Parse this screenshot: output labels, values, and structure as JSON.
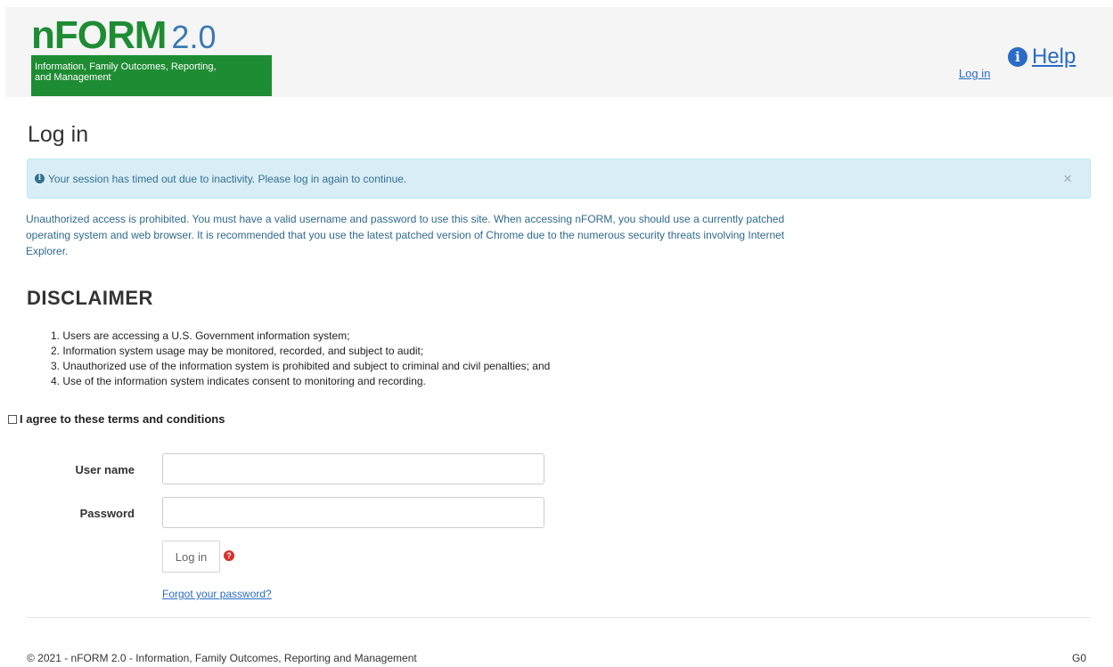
{
  "header": {
    "logo": {
      "n": "n",
      "form": "FORM",
      "version": "2.0",
      "line1": "Information, Family Outcomes, Reporting,",
      "line2": "and Management"
    },
    "login_link": "Log in",
    "help_link": "Help",
    "help_icon": "info-circle-icon"
  },
  "page_title": "Log in",
  "alert": {
    "icon": "info-circle-icon",
    "message": "Your session has timed out due to inactivity. Please log in again to continue.",
    "close": "×"
  },
  "warning": "Unauthorized access is prohibited. You must have a valid username and password to use this site. When accessing nFORM, you should use a currently patched operating system and web browser. It is recommended that you use the latest patched version of Chrome due to the numerous security threats involving Internet Explorer.",
  "disclaimer": {
    "title": "DISCLAIMER",
    "items": [
      "1. Users are accessing a U.S. Government information system;",
      "2. Information system usage may be monitored, recorded, and subject to audit;",
      "3. Unauthorized use of the information system is prohibited and subject to criminal and civil penalties; and",
      "4. Use of the information system indicates consent to monitoring and recording."
    ]
  },
  "agree_label": "I agree to these terms and conditions",
  "form": {
    "username_label": "User name",
    "username_value": "",
    "password_label": "Password",
    "password_value": "",
    "login_button": "Log in",
    "forgot_link": "Forgot your password?"
  },
  "footer": {
    "text": "© 2021 - nFORM 2.0 - Information, Family Outcomes, Reporting and Management",
    "right": "G0"
  },
  "colors": {
    "brand_green": "#1e8c33",
    "link_blue": "#2a6cc5",
    "alert_bg": "#d9edf7",
    "alert_text": "#31708f",
    "required_red": "#d9302c"
  }
}
